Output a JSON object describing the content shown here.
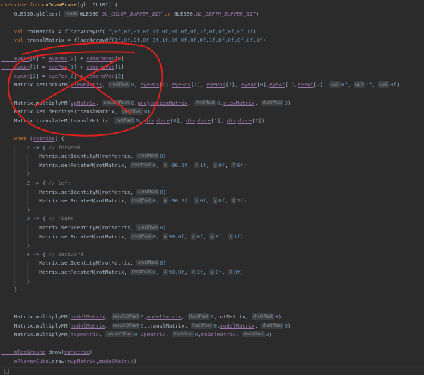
{
  "code_lines": [
    [
      [
        "kw",
        "override fun "
      ],
      [
        "fn",
        "onDrawFrame"
      ],
      [
        "pn",
        "(gl: GL10?) {"
      ]
    ],
    [
      [
        "id",
        "    GLES30.glClear( "
      ],
      [
        "hint",
        "mask"
      ],
      [
        "id",
        "GLES30."
      ],
      [
        "cst",
        "GL_COLOR_BUFFER_BIT"
      ],
      [
        "kw",
        " or "
      ],
      [
        "id",
        "GLES30."
      ],
      [
        "cst",
        "GL_DEPTH_BUFFER_BIT"
      ],
      [
        "pn",
        ")"
      ]
    ],
    [],
    [
      [
        "kw",
        "    val "
      ],
      [
        "id",
        "rotMatrix = "
      ],
      [
        "fnI",
        "floatArrayOf"
      ],
      [
        "pn",
        "("
      ],
      [
        "num",
        "1f"
      ],
      [
        "pn",
        ","
      ],
      [
        "num",
        "0f"
      ],
      [
        "pn",
        ","
      ],
      [
        "num",
        "0f"
      ],
      [
        "pn",
        ","
      ],
      [
        "num",
        "0f"
      ],
      [
        "pn",
        ","
      ],
      [
        "num",
        "0f"
      ],
      [
        "pn",
        ","
      ],
      [
        "num",
        "1f"
      ],
      [
        "pn",
        ","
      ],
      [
        "num",
        "0f"
      ],
      [
        "pn",
        ","
      ],
      [
        "num",
        "0f"
      ],
      [
        "pn",
        ","
      ],
      [
        "num",
        "0f"
      ],
      [
        "pn",
        ","
      ],
      [
        "num",
        "0f"
      ],
      [
        "pn",
        ","
      ],
      [
        "num",
        "1f"
      ],
      [
        "pn",
        ","
      ],
      [
        "num",
        "0f"
      ],
      [
        "pn",
        ","
      ],
      [
        "num",
        "0f"
      ],
      [
        "pn",
        ","
      ],
      [
        "num",
        "0f"
      ],
      [
        "pn",
        ","
      ],
      [
        "num",
        "0f"
      ],
      [
        "pn",
        ","
      ],
      [
        "num",
        "1f"
      ],
      [
        "pn",
        ")"
      ]
    ],
    [
      [
        "kw",
        "    val "
      ],
      [
        "id",
        "translMatrix = "
      ],
      [
        "fnI",
        "floatArrayOf"
      ],
      [
        "pn",
        "("
      ],
      [
        "num",
        "1f"
      ],
      [
        "pn",
        ","
      ],
      [
        "num",
        "0f"
      ],
      [
        "pn",
        ","
      ],
      [
        "num",
        "0f"
      ],
      [
        "pn",
        ","
      ],
      [
        "num",
        "0f"
      ],
      [
        "pn",
        ","
      ],
      [
        "num",
        "0f"
      ],
      [
        "pn",
        ","
      ],
      [
        "num",
        "1f"
      ],
      [
        "pn",
        ","
      ],
      [
        "num",
        "0f"
      ],
      [
        "pn",
        ","
      ],
      [
        "num",
        "0f"
      ],
      [
        "pn",
        ","
      ],
      [
        "num",
        "0f"
      ],
      [
        "pn",
        ","
      ],
      [
        "num",
        "0f"
      ],
      [
        "pn",
        ","
      ],
      [
        "num",
        "1f"
      ],
      [
        "pn",
        ","
      ],
      [
        "num",
        "0f"
      ],
      [
        "pn",
        ","
      ],
      [
        "num",
        "0f"
      ],
      [
        "pn",
        ","
      ],
      [
        "num",
        "0f"
      ],
      [
        "pn",
        ","
      ],
      [
        "num",
        "0f"
      ],
      [
        "pn",
        ","
      ],
      [
        "num",
        "1f"
      ],
      [
        "pn",
        ")"
      ]
    ],
    [],
    [
      [
        "fld",
        "    eyeAt"
      ],
      [
        "pn",
        "["
      ],
      [
        "num",
        "0"
      ],
      [
        "pn",
        "] = "
      ],
      [
        "fld",
        "eyePos"
      ],
      [
        "pn",
        "["
      ],
      [
        "num",
        "0"
      ],
      [
        "pn",
        "] + "
      ],
      [
        "fld",
        "cameraVec"
      ],
      [
        "pn",
        "["
      ],
      [
        "num",
        "0"
      ],
      [
        "pn",
        "]"
      ]
    ],
    [
      [
        "fld",
        "    eyeAt"
      ],
      [
        "pn",
        "["
      ],
      [
        "num",
        "1"
      ],
      [
        "pn",
        "] = "
      ],
      [
        "fld",
        "eyePos"
      ],
      [
        "pn",
        "["
      ],
      [
        "num",
        "1"
      ],
      [
        "pn",
        "] + "
      ],
      [
        "fld",
        "cameraVec"
      ],
      [
        "pn",
        "["
      ],
      [
        "num",
        "1"
      ],
      [
        "pn",
        "]"
      ]
    ],
    [
      [
        "fld",
        "    eyeAt"
      ],
      [
        "pn",
        "["
      ],
      [
        "num",
        "2"
      ],
      [
        "pn",
        "] = "
      ],
      [
        "fld",
        "eyePos"
      ],
      [
        "pn",
        "["
      ],
      [
        "num",
        "2"
      ],
      [
        "pn",
        "] + "
      ],
      [
        "fld",
        "cameraVec"
      ],
      [
        "pn",
        "["
      ],
      [
        "num",
        "2"
      ],
      [
        "pn",
        "]"
      ]
    ],
    [
      [
        "id",
        "    Matrix.setLookAtM("
      ],
      [
        "fld",
        "viewMatrix"
      ],
      [
        "pn",
        ", "
      ],
      [
        "hint",
        "rmOffset"
      ],
      [
        "num",
        "0"
      ],
      [
        "pn",
        ", "
      ],
      [
        "fld",
        "eyePos"
      ],
      [
        "pn",
        "["
      ],
      [
        "num",
        "0"
      ],
      [
        "pn",
        "],"
      ],
      [
        "fld",
        "eyePos"
      ],
      [
        "pn",
        "["
      ],
      [
        "num",
        "1"
      ],
      [
        "pn",
        "], "
      ],
      [
        "fld",
        "eyePos"
      ],
      [
        "pn",
        "["
      ],
      [
        "num",
        "2"
      ],
      [
        "pn",
        "], "
      ],
      [
        "fld",
        "eyeAt"
      ],
      [
        "pn",
        "["
      ],
      [
        "num",
        "0"
      ],
      [
        "pn",
        "],"
      ],
      [
        "fld",
        "eyeAt"
      ],
      [
        "pn",
        "["
      ],
      [
        "num",
        "1"
      ],
      [
        "pn",
        "],"
      ],
      [
        "fld",
        "eyeAt"
      ],
      [
        "pn",
        "["
      ],
      [
        "num",
        "2"
      ],
      [
        "pn",
        "], "
      ],
      [
        "hint",
        "upX"
      ],
      [
        "num",
        "0f"
      ],
      [
        "pn",
        ", "
      ],
      [
        "hint",
        "upY"
      ],
      [
        "num",
        "1f"
      ],
      [
        "pn",
        ", "
      ],
      [
        "hint",
        "upZ"
      ],
      [
        "num",
        "0f"
      ],
      [
        "pn",
        ")"
      ]
    ],
    [],
    [
      [
        "id",
        "    Matrix.multiplyMM("
      ],
      [
        "fld",
        "vpMatrix"
      ],
      [
        "pn",
        ", "
      ],
      [
        "hint",
        "resultOffset"
      ],
      [
        "num",
        "0"
      ],
      [
        "pn",
        ","
      ],
      [
        "fld",
        "projectionMatrix"
      ],
      [
        "pn",
        ", "
      ],
      [
        "hint",
        "lhsOffset"
      ],
      [
        "num",
        "0"
      ],
      [
        "pn",
        ","
      ],
      [
        "fld",
        "viewMatrix"
      ],
      [
        "pn",
        ", "
      ],
      [
        "hint",
        "rhsOffset"
      ],
      [
        "num",
        "0"
      ],
      [
        "pn",
        ")"
      ]
    ],
    [
      [
        "id",
        "    Matrix.setIdentityM(translMatrix, "
      ],
      [
        "hint",
        "smOffset"
      ],
      [
        "num",
        "0"
      ],
      [
        "pn",
        ")"
      ]
    ],
    [
      [
        "id",
        "    Matrix.translateM(translMatrix, "
      ],
      [
        "hint",
        "mOffset"
      ],
      [
        "num",
        "0"
      ],
      [
        "pn",
        ", "
      ],
      [
        "fld",
        "displace"
      ],
      [
        "pn",
        "["
      ],
      [
        "num",
        "0"
      ],
      [
        "pn",
        "], "
      ],
      [
        "fld",
        "displace"
      ],
      [
        "pn",
        "["
      ],
      [
        "num",
        "1"
      ],
      [
        "pn",
        "], "
      ],
      [
        "fld",
        "displace"
      ],
      [
        "pn",
        "["
      ],
      [
        "num",
        "2"
      ],
      [
        "pn",
        "])"
      ]
    ],
    [],
    [
      [
        "kw",
        "    when "
      ],
      [
        "pn",
        "("
      ],
      [
        "fld",
        "rotAxis"
      ],
      [
        "pn",
        ") {"
      ]
    ],
    [
      [
        "num",
        "        1"
      ],
      [
        "pn",
        " -> { "
      ],
      [
        "cm",
        "// forward"
      ]
    ],
    [
      [
        "id",
        "            Matrix.setIdentityM(rotMatrix, "
      ],
      [
        "hint",
        "smOffset"
      ],
      [
        "num",
        "0"
      ],
      [
        "pn",
        ")"
      ]
    ],
    [
      [
        "id",
        "            Matrix.setRotateM(rotMatrix, "
      ],
      [
        "hint",
        "rmOffset"
      ],
      [
        "num",
        "0"
      ],
      [
        "pn",
        ", "
      ],
      [
        "hint",
        "a"
      ],
      [
        "num",
        "-90.0f"
      ],
      [
        "pn",
        ", "
      ],
      [
        "hint",
        "x"
      ],
      [
        "num",
        "1f"
      ],
      [
        "pn",
        ", "
      ],
      [
        "hint",
        "y"
      ],
      [
        "num",
        "0f"
      ],
      [
        "pn",
        ", "
      ],
      [
        "hint",
        "z"
      ],
      [
        "num",
        "0f"
      ],
      [
        "pn",
        ")"
      ]
    ],
    [
      [
        "pn",
        "        }"
      ]
    ],
    [
      [
        "num",
        "        2"
      ],
      [
        "pn",
        " -> { "
      ],
      [
        "cm",
        "// left"
      ]
    ],
    [
      [
        "id",
        "            Matrix.setIdentityM(rotMatrix, "
      ],
      [
        "hint",
        "smOffset"
      ],
      [
        "num",
        "0"
      ],
      [
        "pn",
        ")"
      ]
    ],
    [
      [
        "id",
        "            Matrix.setRotateM(rotMatrix, "
      ],
      [
        "hint",
        "rmOffset"
      ],
      [
        "num",
        "0"
      ],
      [
        "pn",
        ", "
      ],
      [
        "hint",
        "a"
      ],
      [
        "num",
        "-90.0f"
      ],
      [
        "pn",
        ", "
      ],
      [
        "hint",
        "x"
      ],
      [
        "num",
        "0f"
      ],
      [
        "pn",
        ", "
      ],
      [
        "hint",
        "y"
      ],
      [
        "num",
        "0f"
      ],
      [
        "pn",
        ", "
      ],
      [
        "hint",
        "z"
      ],
      [
        "num",
        "1f"
      ],
      [
        "pn",
        ")"
      ]
    ],
    [
      [
        "pn",
        "        }"
      ]
    ],
    [
      [
        "num",
        "        3"
      ],
      [
        "pn",
        " -> { "
      ],
      [
        "cm",
        "// right"
      ]
    ],
    [
      [
        "id",
        "            Matrix.setIdentityM(rotMatrix, "
      ],
      [
        "hint",
        "smOffset"
      ],
      [
        "num",
        "0"
      ],
      [
        "pn",
        ")"
      ]
    ],
    [
      [
        "id",
        "            Matrix.setRotateM(rotMatrix, "
      ],
      [
        "hint",
        "rmOffset"
      ],
      [
        "num",
        "0"
      ],
      [
        "pn",
        ", "
      ],
      [
        "hint",
        "a"
      ],
      [
        "num",
        "90.0f"
      ],
      [
        "pn",
        ", "
      ],
      [
        "hint",
        "x"
      ],
      [
        "num",
        "0f"
      ],
      [
        "pn",
        ", "
      ],
      [
        "hint",
        "y"
      ],
      [
        "num",
        "0f"
      ],
      [
        "pn",
        ", "
      ],
      [
        "hint",
        "z"
      ],
      [
        "num",
        "1f"
      ],
      [
        "pn",
        ")"
      ]
    ],
    [
      [
        "pn",
        "        }"
      ]
    ],
    [
      [
        "num",
        "        4"
      ],
      [
        "pn",
        " -> { "
      ],
      [
        "cm",
        "// backward"
      ]
    ],
    [
      [
        "id",
        "            Matrix.setIdentityM(rotMatrix, "
      ],
      [
        "hint",
        "smOffset"
      ],
      [
        "num",
        "0"
      ],
      [
        "pn",
        ")"
      ]
    ],
    [
      [
        "id",
        "            Matrix.setRotateM(rotMatrix, "
      ],
      [
        "hint",
        "rmOffset"
      ],
      [
        "num",
        "0"
      ],
      [
        "pn",
        ", "
      ],
      [
        "hint",
        "a"
      ],
      [
        "num",
        "90.0f"
      ],
      [
        "pn",
        ", "
      ],
      [
        "hint",
        "x"
      ],
      [
        "num",
        "1f"
      ],
      [
        "pn",
        ", "
      ],
      [
        "hint",
        "y"
      ],
      [
        "num",
        "0f"
      ],
      [
        "pn",
        ", "
      ],
      [
        "hint",
        "z"
      ],
      [
        "num",
        "0f"
      ],
      [
        "pn",
        ")"
      ]
    ],
    [
      [
        "pn",
        "        }"
      ]
    ],
    [
      [
        "pn",
        "    }"
      ]
    ],
    [],
    [],
    [
      [
        "id",
        "    Matrix.multiplyMM("
      ],
      [
        "fld",
        "modelMatrix"
      ],
      [
        "pn",
        ", "
      ],
      [
        "hint",
        "resultOffset"
      ],
      [
        "num",
        "0"
      ],
      [
        "pn",
        ","
      ],
      [
        "fld",
        "modelMatrix"
      ],
      [
        "pn",
        ", "
      ],
      [
        "hint",
        "lhsOffset"
      ],
      [
        "num",
        "0"
      ],
      [
        "pn",
        ",rotMatrix, "
      ],
      [
        "hint",
        "rhsOffset"
      ],
      [
        "num",
        "0"
      ],
      [
        "pn",
        ")"
      ]
    ],
    [
      [
        "id",
        "    Matrix.multiplyMM("
      ],
      [
        "fld",
        "modelMatrix"
      ],
      [
        "pn",
        ", "
      ],
      [
        "hint",
        "resultOffset"
      ],
      [
        "num",
        "0"
      ],
      [
        "pn",
        ","
      ],
      [
        "id",
        "translMatrix, "
      ],
      [
        "hint",
        "lhsOffset"
      ],
      [
        "num",
        "0"
      ],
      [
        "pn",
        ","
      ],
      [
        "fld",
        "modelMatrix"
      ],
      [
        "pn",
        ", "
      ],
      [
        "hint",
        "rhsOffset"
      ],
      [
        "num",
        "0"
      ],
      [
        "pn",
        ")"
      ]
    ],
    [
      [
        "id",
        "    Matrix.multiplyMM("
      ],
      [
        "fld",
        "mvpMatrix"
      ],
      [
        "pn",
        ", "
      ],
      [
        "hint",
        "resultOffset"
      ],
      [
        "num",
        "0"
      ],
      [
        "pn",
        ","
      ],
      [
        "fld",
        "vpMatrix"
      ],
      [
        "pn",
        ", "
      ],
      [
        "hint",
        "lhsOffset"
      ],
      [
        "num",
        "0"
      ],
      [
        "pn",
        ","
      ],
      [
        "fld",
        "modelMatrix"
      ],
      [
        "pn",
        ", "
      ],
      [
        "hint",
        "rhsOffset"
      ],
      [
        "num",
        "0"
      ],
      [
        "pn",
        ")"
      ]
    ],
    [],
    [
      [
        "fld",
        "    mTexGround"
      ],
      [
        "pn",
        ".draw("
      ],
      [
        "fld",
        "vpMatrix"
      ],
      [
        "pn",
        ")"
      ]
    ],
    [
      [
        "fld",
        "    mPlayerCube"
      ],
      [
        "pn",
        ".draw("
      ],
      [
        "fld",
        "mvpMatrix"
      ],
      [
        "pn",
        ","
      ],
      [
        "fld",
        "modelMatrix"
      ],
      [
        "pn",
        ")"
      ]
    ],
    [
      [
        "pn",
        "}"
      ]
    ]
  ],
  "annotation": {
    "kind": "hand-drawn-circle-and-cross",
    "color": "#e0201c"
  }
}
